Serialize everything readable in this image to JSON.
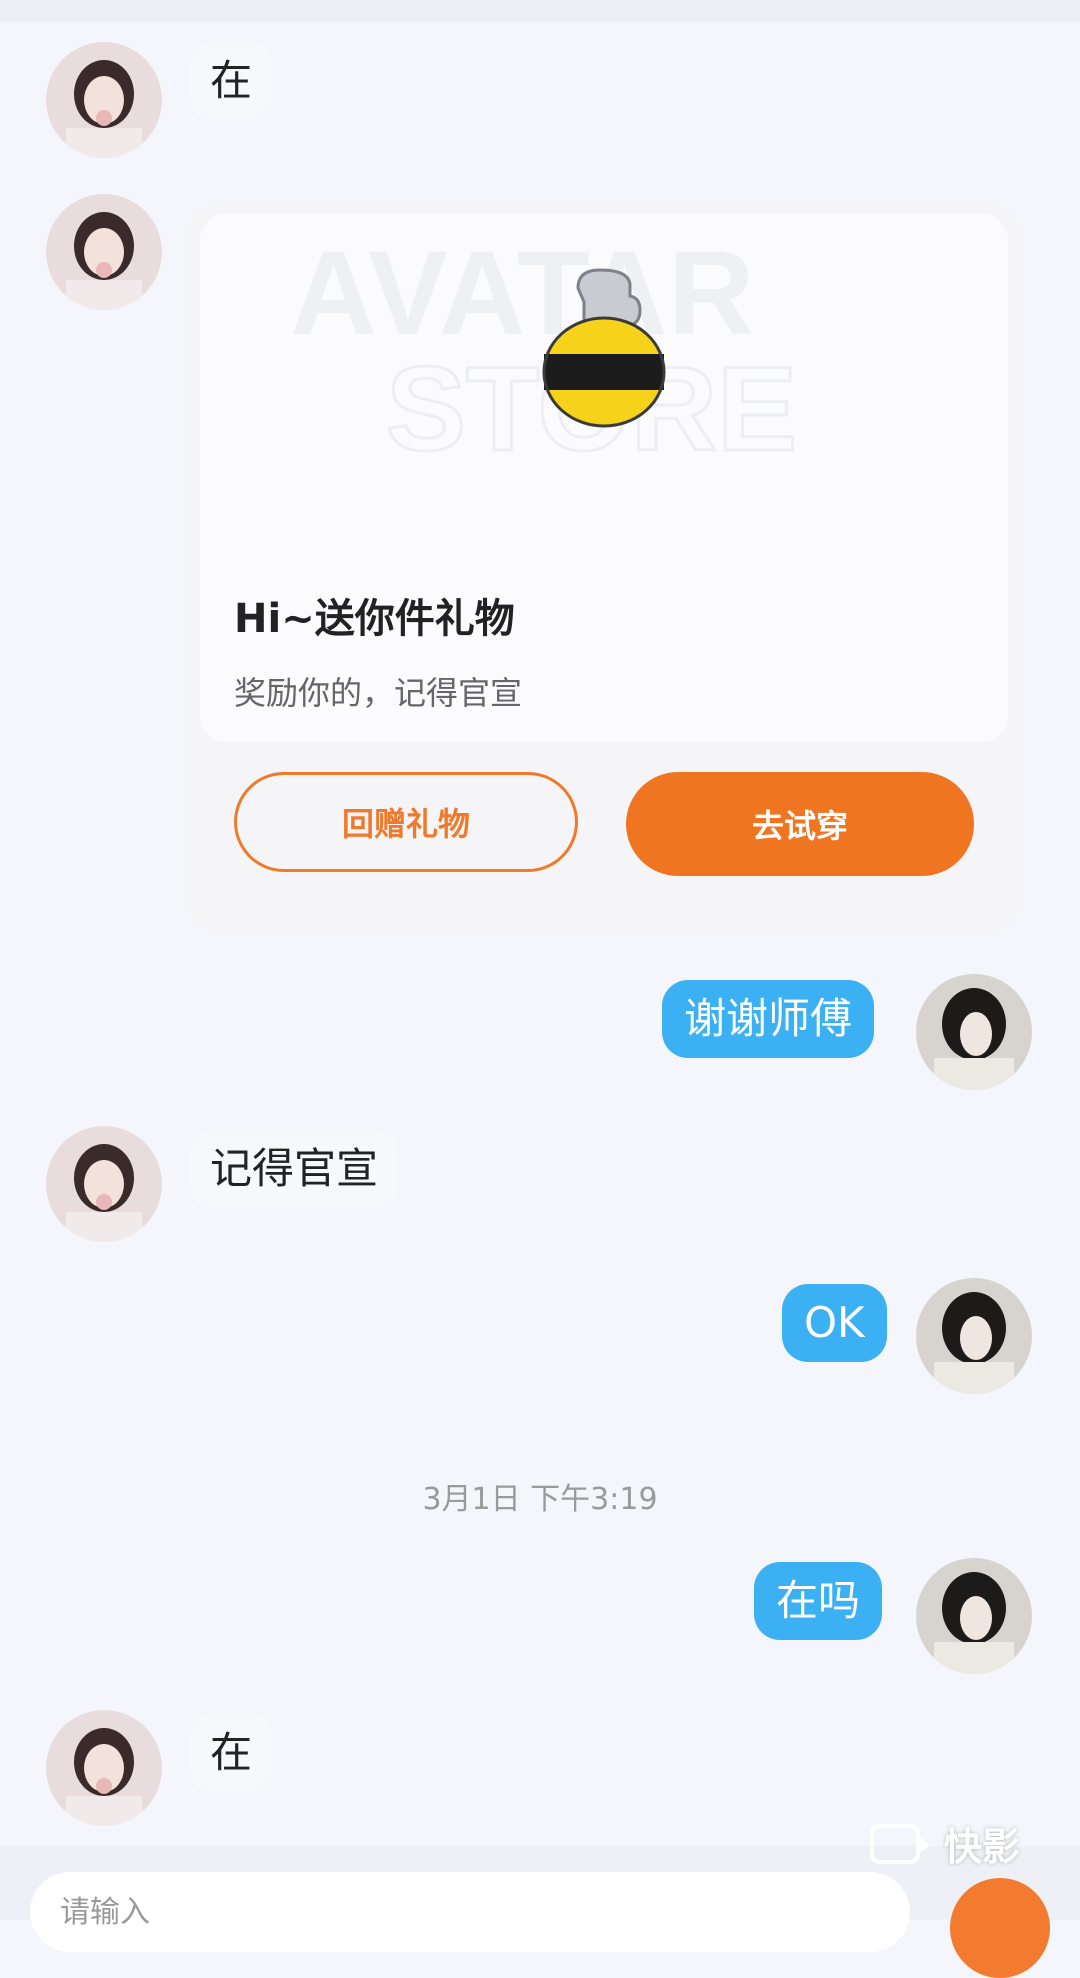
{
  "messages": [
    {
      "side": "in",
      "text": "在"
    },
    {
      "side": "out",
      "text": "谢谢师傅"
    },
    {
      "side": "in",
      "text": "记得官宣"
    },
    {
      "side": "out",
      "text": "OK"
    },
    {
      "side": "out",
      "text": "在吗"
    },
    {
      "side": "in",
      "text": "在"
    }
  ],
  "gift_card": {
    "store_watermark_line1": "AVATAR",
    "store_watermark_line2": "STORE",
    "title": "Hi~送你件礼物",
    "subtitle": "奖励你的，记得官宣",
    "return_button": "回赠礼物",
    "try_button": "去试穿",
    "accent_color": "#ef7521"
  },
  "timestamp": "3月1日 下午3:19",
  "input": {
    "placeholder": "请输入"
  },
  "watermark": {
    "brand": "快影"
  },
  "colors": {
    "outgoing_bubble": "#3bb0f3",
    "background": "#f4f6fb"
  }
}
